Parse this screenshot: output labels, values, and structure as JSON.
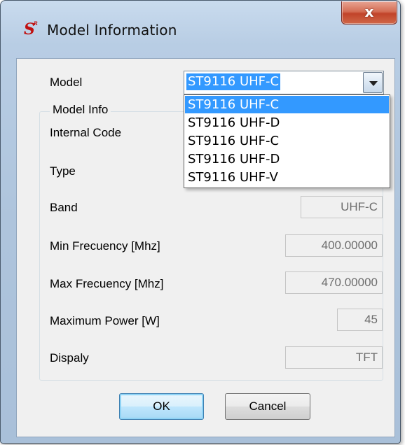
{
  "window": {
    "title": "Model Information",
    "close_label": "x"
  },
  "model": {
    "label": "Model",
    "selected": "ST9116 UHF-C",
    "options": [
      "ST9116 UHF-C",
      "ST9116 UHF-D",
      "ST9116 UHF-C",
      "ST9116 UHF-D",
      "ST9116 UHF-V"
    ]
  },
  "model_info": {
    "group_title": "Model Info",
    "internal_code": {
      "label": "Internal Code",
      "value": ""
    },
    "type": {
      "label": "Type",
      "value": ""
    },
    "band": {
      "label": "Band",
      "value": "UHF-C"
    },
    "min_freq": {
      "label": "Min Frecuency [Mhz]",
      "value": "400.00000"
    },
    "max_freq": {
      "label": "Max Frecuency [Mhz]",
      "value": "470.00000"
    },
    "max_power": {
      "label": "Maximum Power [W]",
      "value": "45"
    },
    "display": {
      "label": "Dispaly",
      "value": "TFT"
    }
  },
  "buttons": {
    "ok": "OK",
    "cancel": "Cancel"
  },
  "colors": {
    "selection": "#3399ff",
    "close_button": "#c1442a",
    "app_icon": "#c01010"
  }
}
